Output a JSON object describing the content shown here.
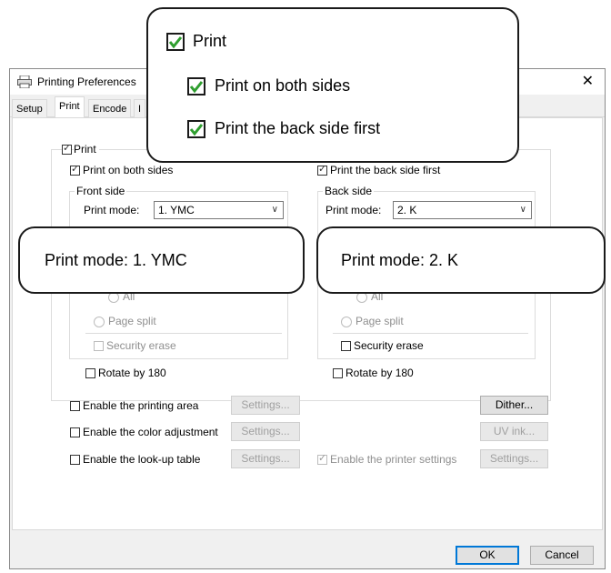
{
  "window": {
    "title": "Printing Preferences",
    "close_glyph": "✕"
  },
  "tabs": [
    {
      "label": "Setup"
    },
    {
      "label": "Print"
    },
    {
      "label": "Encode"
    },
    {
      "label": "I"
    }
  ],
  "print": {
    "print_label": "Print",
    "both_sides_label": "Print on both sides",
    "back_first_label": "Print the back side first",
    "front": {
      "group_title": "Front side",
      "mode_label": "Print mode:",
      "mode_value": "1. YMC",
      "all_label": "All",
      "page_split_label": "Page split",
      "security_erase_label": "Security erase",
      "rotate_label": "Rotate by 180"
    },
    "back": {
      "group_title": "Back side",
      "mode_label": "Print mode:",
      "mode_value": "2. K",
      "all_label": "All",
      "page_split_label": "Page split",
      "security_erase_label": "Security erase",
      "rotate_label": "Rotate by 180"
    }
  },
  "options": {
    "printing_area_label": "Enable the printing area",
    "color_adjust_label": "Enable the color adjustment",
    "lookup_label": "Enable the look-up table",
    "printer_settings_label": "Enable the printer settings",
    "settings_btn": "Settings...",
    "dither_btn": "Dither...",
    "uvink_btn": "UV ink..."
  },
  "footer": {
    "ok": "OK",
    "cancel": "Cancel"
  },
  "callouts": {
    "print": "Print",
    "both_sides": "Print on both sides",
    "back_first": "Print the back side first",
    "front_mode": "Print mode:   1. YMC",
    "back_mode": "Print mode:   2. K"
  },
  "colors": {
    "check_green": "#2e9e2e",
    "accent": "#0078d7"
  }
}
